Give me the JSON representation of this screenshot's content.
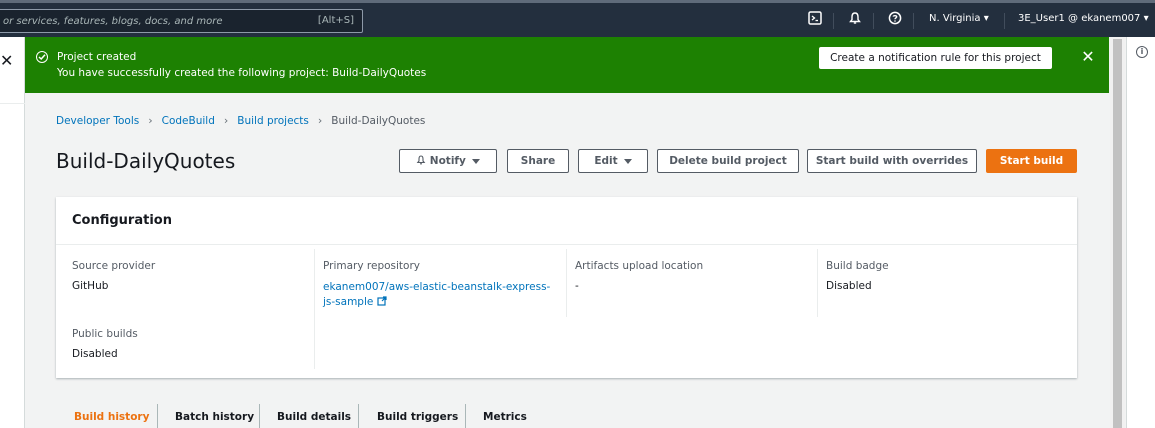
{
  "topnav": {
    "search_placeholder": "or services, features, blogs, docs, and more",
    "search_shortcut": "[Alt+S]",
    "region": "N. Virginia",
    "account": "3E_User1 @ ekanem007"
  },
  "flash": {
    "title": "Project created",
    "message": "You have successfully created the following project: Build-DailyQuotes",
    "action_label": "Create a notification rule for this project",
    "status_color": "#1d8102"
  },
  "breadcrumb": {
    "items": [
      "Developer Tools",
      "CodeBuild",
      "Build projects"
    ],
    "current": "Build-DailyQuotes"
  },
  "page": {
    "title": "Build-DailyQuotes",
    "buttons": {
      "notify": "Notify",
      "share": "Share",
      "edit": "Edit",
      "delete": "Delete build project",
      "start_overrides": "Start build with overrides",
      "start": "Start build"
    },
    "accent_color": "#ec7211"
  },
  "configuration": {
    "heading": "Configuration",
    "source_provider": {
      "label": "Source provider",
      "value": "GitHub"
    },
    "primary_repository": {
      "label": "Primary repository",
      "value": "ekanem007/aws-elastic-beanstalk-express-js-sample"
    },
    "artifacts": {
      "label": "Artifacts upload location",
      "value": "-"
    },
    "build_badge": {
      "label": "Build badge",
      "value": "Disabled"
    },
    "public_builds": {
      "label": "Public builds",
      "value": "Disabled"
    }
  },
  "tabs": [
    "Build history",
    "Batch history",
    "Build details",
    "Build triggers",
    "Metrics"
  ],
  "active_tab": "Build history"
}
